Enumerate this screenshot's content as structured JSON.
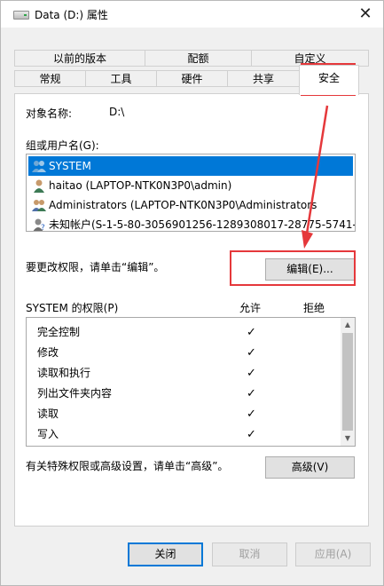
{
  "title": "Data (D:) 属性",
  "close_symbol": "✕",
  "tabs_row1": [
    "以前的版本",
    "配额",
    "自定义"
  ],
  "tabs_row2": [
    "常规",
    "工具",
    "硬件",
    "共享"
  ],
  "active_tab": "安全",
  "object_label": "对象名称:",
  "object_value": "D:\\",
  "groups_label": "组或用户名(G):",
  "users": [
    {
      "name": "SYSTEM",
      "icon": "user-group-icon",
      "selected": true
    },
    {
      "name": "haitao (LAPTOP-NTK0N3P0\\admin)",
      "icon": "user-icon",
      "selected": false
    },
    {
      "name": "Administrators (LAPTOP-NTK0N3P0\\Administrators",
      "icon": "user-group-icon",
      "selected": false
    },
    {
      "name": "未知帐户(S-1-5-80-3056901256-1289308017-28775-5741-...",
      "icon": "unknown-user-icon",
      "selected": false
    }
  ],
  "change_perm_text": "要更改权限，请单击“编辑”。",
  "edit_button": "编辑(E)...",
  "perm_header": "SYSTEM 的权限(P)",
  "allow_label": "允许",
  "deny_label": "拒绝",
  "permissions": [
    {
      "name": "完全控制",
      "allow": "✓"
    },
    {
      "name": "修改",
      "allow": "✓"
    },
    {
      "name": "读取和执行",
      "allow": "✓"
    },
    {
      "name": "列出文件夹内容",
      "allow": "✓"
    },
    {
      "name": "读取",
      "allow": "✓"
    },
    {
      "name": "写入",
      "allow": "✓"
    }
  ],
  "advanced_text": "有关特殊权限或高级设置，请单击“高级”。",
  "advanced_button": "高级(V)",
  "footer": {
    "close": "关闭",
    "cancel": "取消",
    "apply": "应用(A)"
  },
  "colors": {
    "selection": "#0078d7",
    "annotation": "#e5383b"
  }
}
